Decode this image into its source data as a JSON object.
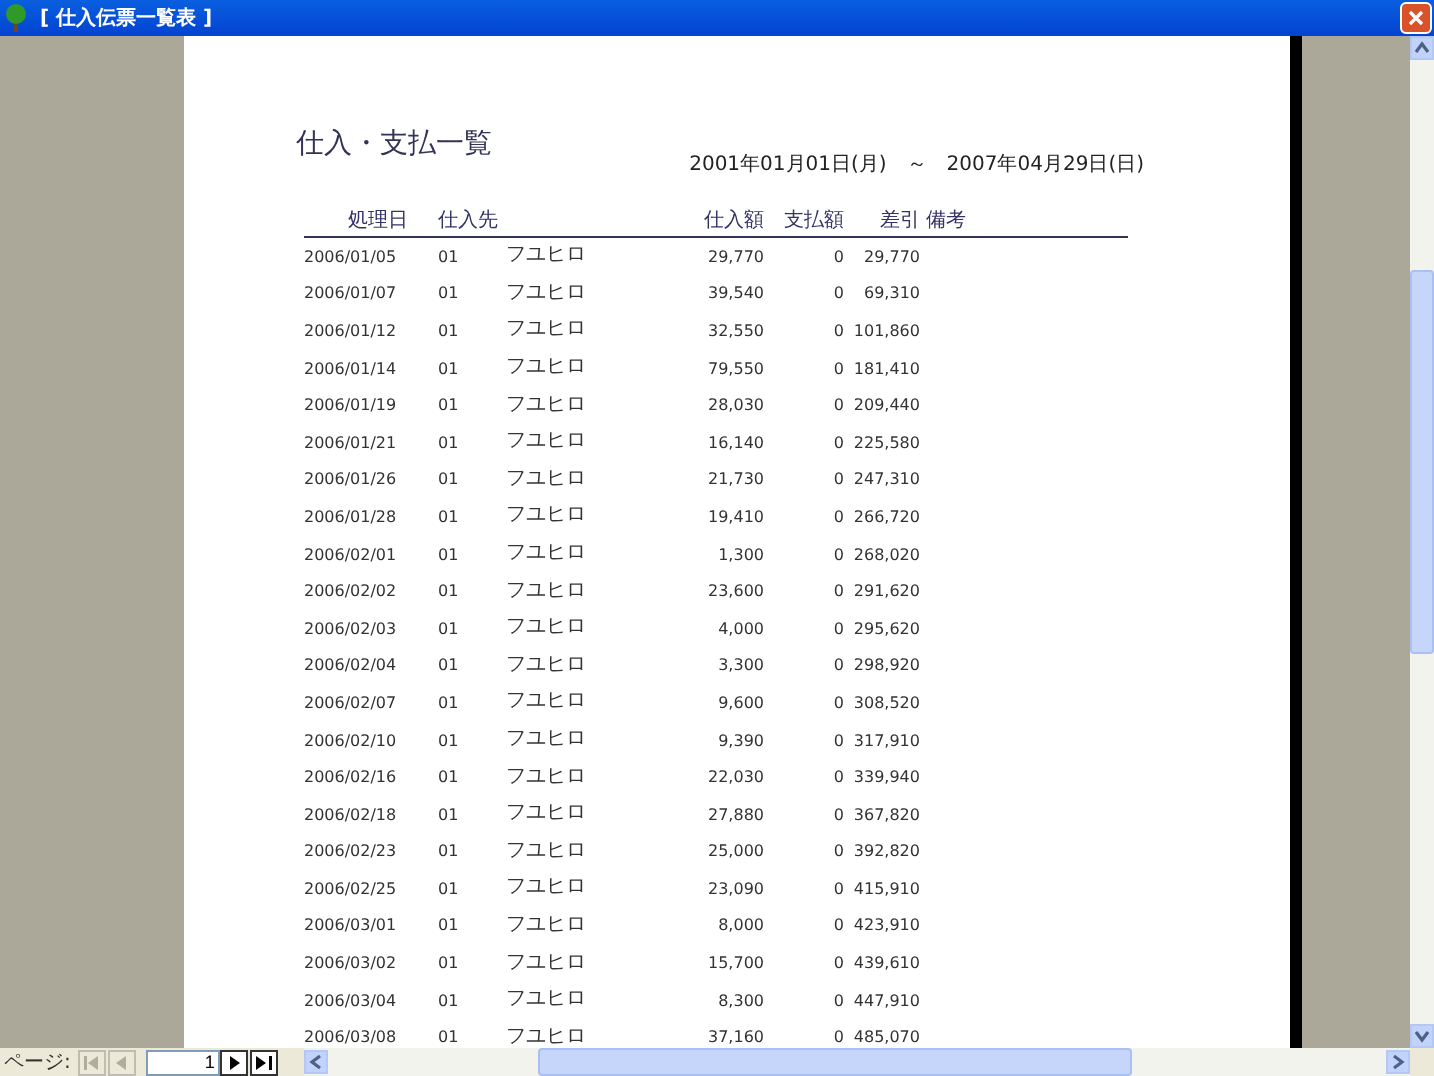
{
  "window": {
    "title": "[ 仕入伝票一覧表 ]"
  },
  "report": {
    "title": "仕入・支払一覧",
    "date_from": "2001年01月01日(月)",
    "date_separator": "～",
    "date_to": "2007年04月29日(日)",
    "columns": [
      "処理日",
      "仕入先",
      "仕入額",
      "支払額",
      "差引",
      "備考"
    ],
    "rows": [
      {
        "date": "2006/01/05",
        "code": "01",
        "supplier": "フユヒロ",
        "purchase": "29,770",
        "payment": "0",
        "balance": "29,770"
      },
      {
        "date": "2006/01/07",
        "code": "01",
        "supplier": "フユヒロ",
        "purchase": "39,540",
        "payment": "0",
        "balance": "69,310"
      },
      {
        "date": "2006/01/12",
        "code": "01",
        "supplier": "フユヒロ",
        "purchase": "32,550",
        "payment": "0",
        "balance": "101,860"
      },
      {
        "date": "2006/01/14",
        "code": "01",
        "supplier": "フユヒロ",
        "purchase": "79,550",
        "payment": "0",
        "balance": "181,410"
      },
      {
        "date": "2006/01/19",
        "code": "01",
        "supplier": "フユヒロ",
        "purchase": "28,030",
        "payment": "0",
        "balance": "209,440"
      },
      {
        "date": "2006/01/21",
        "code": "01",
        "supplier": "フユヒロ",
        "purchase": "16,140",
        "payment": "0",
        "balance": "225,580"
      },
      {
        "date": "2006/01/26",
        "code": "01",
        "supplier": "フユヒロ",
        "purchase": "21,730",
        "payment": "0",
        "balance": "247,310"
      },
      {
        "date": "2006/01/28",
        "code": "01",
        "supplier": "フユヒロ",
        "purchase": "19,410",
        "payment": "0",
        "balance": "266,720"
      },
      {
        "date": "2006/02/01",
        "code": "01",
        "supplier": "フユヒロ",
        "purchase": "1,300",
        "payment": "0",
        "balance": "268,020"
      },
      {
        "date": "2006/02/02",
        "code": "01",
        "supplier": "フユヒロ",
        "purchase": "23,600",
        "payment": "0",
        "balance": "291,620"
      },
      {
        "date": "2006/02/03",
        "code": "01",
        "supplier": "フユヒロ",
        "purchase": "4,000",
        "payment": "0",
        "balance": "295,620"
      },
      {
        "date": "2006/02/04",
        "code": "01",
        "supplier": "フユヒロ",
        "purchase": "3,300",
        "payment": "0",
        "balance": "298,920"
      },
      {
        "date": "2006/02/07",
        "code": "01",
        "supplier": "フユヒロ",
        "purchase": "9,600",
        "payment": "0",
        "balance": "308,520"
      },
      {
        "date": "2006/02/10",
        "code": "01",
        "supplier": "フユヒロ",
        "purchase": "9,390",
        "payment": "0",
        "balance": "317,910"
      },
      {
        "date": "2006/02/16",
        "code": "01",
        "supplier": "フユヒロ",
        "purchase": "22,030",
        "payment": "0",
        "balance": "339,940"
      },
      {
        "date": "2006/02/18",
        "code": "01",
        "supplier": "フユヒロ",
        "purchase": "27,880",
        "payment": "0",
        "balance": "367,820"
      },
      {
        "date": "2006/02/23",
        "code": "01",
        "supplier": "フユヒロ",
        "purchase": "25,000",
        "payment": "0",
        "balance": "392,820"
      },
      {
        "date": "2006/02/25",
        "code": "01",
        "supplier": "フユヒロ",
        "purchase": "23,090",
        "payment": "0",
        "balance": "415,910"
      },
      {
        "date": "2006/03/01",
        "code": "01",
        "supplier": "フユヒロ",
        "purchase": "8,000",
        "payment": "0",
        "balance": "423,910"
      },
      {
        "date": "2006/03/02",
        "code": "01",
        "supplier": "フユヒロ",
        "purchase": "15,700",
        "payment": "0",
        "balance": "439,610"
      },
      {
        "date": "2006/03/04",
        "code": "01",
        "supplier": "フユヒロ",
        "purchase": "8,300",
        "payment": "0",
        "balance": "447,910"
      },
      {
        "date": "2006/03/08",
        "code": "01",
        "supplier": "フユヒロ",
        "purchase": "37,160",
        "payment": "0",
        "balance": "485,070"
      }
    ]
  },
  "pager": {
    "label": "ページ:",
    "page": "1",
    "buttons": [
      {
        "kind": "first",
        "disabled": true
      },
      {
        "kind": "prev",
        "disabled": true
      },
      {
        "kind": "next",
        "disabled": false
      },
      {
        "kind": "last",
        "disabled": false
      }
    ]
  }
}
